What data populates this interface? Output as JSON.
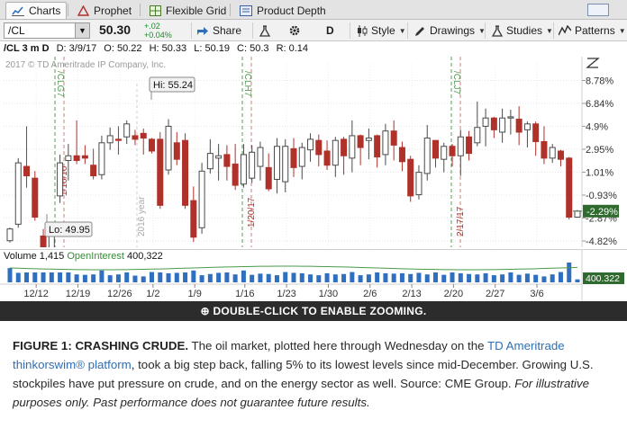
{
  "tabs": [
    {
      "label": "Charts",
      "icon": "chart-icon",
      "active": true
    },
    {
      "label": "Prophet",
      "icon": "prophet-icon",
      "active": false
    },
    {
      "label": "Flexible Grid",
      "icon": "grid-icon",
      "active": false
    },
    {
      "label": "Product Depth",
      "icon": "depth-icon",
      "active": false
    }
  ],
  "toolbar": {
    "symbol": "/CL",
    "last": "50.30",
    "change": "+.02",
    "change_pct": "+0.04%",
    "share": "Share",
    "period": "D",
    "style": "Style",
    "drawings": "Drawings",
    "studies": "Studies",
    "patterns": "Patterns"
  },
  "info": {
    "symbol": "/CL 3 m D",
    "date": "D: 3/9/17",
    "open": "O: 50.22",
    "high": "H: 50.33",
    "low": "L: 50.19",
    "close": "C: 50.3",
    "range": "R: 0.14"
  },
  "copyright": "2017 © TD Ameritrade IP Company, Inc.",
  "chart_data": {
    "type": "candlestick",
    "y_axis": {
      "unit": "percent",
      "ticks": [
        "8.78%",
        "6.84%",
        "4.9%",
        "2.95%",
        "1.01%",
        "-0.93%",
        "-2.87%",
        "-4.82%"
      ]
    },
    "x_ticks": [
      "12/12",
      "12/19",
      "12/26",
      "1/2",
      "1/9",
      "1/16",
      "1/23",
      "1/30",
      "2/6",
      "2/13",
      "2/20",
      "2/27",
      "3/6"
    ],
    "current_value_label": "-2.29%",
    "hi_label": "Hi: 55.24",
    "lo_label": "Lo: 49.95",
    "expiry_markers": [
      "/CLG7",
      "1/16/16",
      "/CLH7",
      "1/20/17",
      "/CLJ7",
      "2/17/17"
    ],
    "year_marker": "2016 year",
    "candles": [
      [
        -4.8,
        -3.8,
        -4.95,
        -3.7
      ],
      [
        -3.4,
        1.8,
        -3.7,
        2.2
      ],
      [
        1.5,
        0.7,
        -0.3,
        4.9
      ],
      [
        0.5,
        -2.8,
        -3.1,
        1.1
      ],
      [
        -4.4,
        -6.2,
        -6.7,
        -3.8
      ],
      [
        -5.5,
        -3.7,
        -5.8,
        -3.3
      ],
      [
        -1.0,
        1.8,
        -1.6,
        2.5
      ],
      [
        2.0,
        2.4,
        0.3,
        3.4
      ],
      [
        2.4,
        2.0,
        1.7,
        5.4
      ],
      [
        2.4,
        2.2,
        1.7,
        3.3
      ],
      [
        1.6,
        0.7,
        0.4,
        3.0
      ],
      [
        0.8,
        3.5,
        0.4,
        4.1
      ],
      [
        3.5,
        4.1,
        2.9,
        4.8
      ],
      [
        3.8,
        3.7,
        2.5,
        4.9
      ],
      [
        4.0,
        5.1,
        3.4,
        5.4
      ],
      [
        4.1,
        3.8,
        3.3,
        4.6
      ],
      [
        4.3,
        3.9,
        2.5,
        4.7
      ],
      [
        3.8,
        2.8,
        2.6,
        3.9
      ],
      [
        3.8,
        -1.8,
        -2.1,
        4.4
      ],
      [
        1.2,
        4.9,
        0.8,
        5.5
      ],
      [
        3.5,
        2.1,
        1.6,
        4.4
      ],
      [
        3.7,
        -1.8,
        -2.1,
        4.3
      ],
      [
        -1.4,
        -4.5,
        -4.9,
        -0.2
      ],
      [
        -3.7,
        1.1,
        -4.2,
        1.8
      ],
      [
        1.3,
        2.6,
        0.9,
        3.8
      ],
      [
        2.2,
        2.4,
        0.3,
        3.4
      ],
      [
        2.5,
        1.5,
        0.3,
        3.3
      ],
      [
        1.7,
        -0.1,
        -0.5,
        3.4
      ],
      [
        0.0,
        2.5,
        -0.3,
        3.4
      ],
      [
        0.5,
        2.7,
        0.1,
        3.3
      ],
      [
        1.5,
        3.1,
        0.3,
        3.6
      ],
      [
        1.4,
        -0.4,
        -0.6,
        2.6
      ],
      [
        0.4,
        3.2,
        -0.8,
        3.9
      ],
      [
        0.2,
        3.2,
        -0.7,
        3.8
      ],
      [
        3.0,
        1.4,
        0.6,
        3.9
      ],
      [
        1.5,
        3.1,
        0.4,
        3.5
      ],
      [
        2.9,
        3.8,
        1.9,
        4.3
      ],
      [
        3.7,
        2.5,
        1.5,
        4.2
      ],
      [
        2.8,
        1.6,
        1.2,
        3.7
      ],
      [
        1.6,
        3.7,
        0.6,
        4.0
      ],
      [
        3.8,
        2.4,
        0.8,
        4.0
      ],
      [
        2.2,
        4.1,
        1.0,
        5.4
      ],
      [
        4.1,
        3.1,
        1.6,
        4.2
      ],
      [
        3.7,
        3.9,
        2.1,
        4.7
      ],
      [
        4.1,
        2.3,
        1.4,
        4.2
      ],
      [
        2.5,
        4.5,
        1.6,
        5.1
      ],
      [
        4.5,
        3.3,
        2.0,
        5.4
      ],
      [
        3.1,
        1.9,
        1.1,
        3.6
      ],
      [
        2.1,
        -1.0,
        -1.5,
        2.4
      ],
      [
        -0.9,
        1.0,
        -1.3,
        1.6
      ],
      [
        0.9,
        3.9,
        0.3,
        5.0
      ],
      [
        3.7,
        2.2,
        1.4,
        3.7
      ],
      [
        2.1,
        3.2,
        1.0,
        3.5
      ],
      [
        3.2,
        2.4,
        1.5,
        3.4
      ],
      [
        2.4,
        4.0,
        0.7,
        4.6
      ],
      [
        4.0,
        2.6,
        2.0,
        4.5
      ],
      [
        3.5,
        4.8,
        3.2,
        7.0
      ],
      [
        4.9,
        5.6,
        3.2,
        6.4
      ],
      [
        5.6,
        4.6,
        3.9,
        5.7
      ],
      [
        4.4,
        5.6,
        3.5,
        6.4
      ],
      [
        5.6,
        5.7,
        4.2,
        6.3
      ],
      [
        5.5,
        4.4,
        3.3,
        6.6
      ],
      [
        4.6,
        5.1,
        3.1,
        5.3
      ],
      [
        5.1,
        3.6,
        2.4,
        5.3
      ],
      [
        3.6,
        2.2,
        1.7,
        4.9
      ],
      [
        2.2,
        3.1,
        1.8,
        3.4
      ],
      [
        2.8,
        2.1,
        1.5,
        2.9
      ],
      [
        2.2,
        -2.8,
        -3.0,
        2.3
      ],
      [
        -2.8,
        -2.29,
        -2.8,
        -2.2
      ]
    ],
    "volume": {
      "label": "Volume",
      "value": "1,415",
      "oi_label": "OpenInterest",
      "oi_value": "400,322",
      "axis_label": "400.322"
    }
  },
  "banner": "DOUBLE-CLICK TO ENABLE ZOOMING.",
  "caption": {
    "title": "FIGURE 1: CRASHING CRUDE.",
    "text1": " The oil market, plotted here through Wednesday on the ",
    "link": "TD Ameritrade thinkorswim® platform",
    "text2": ", took a big step back, falling 5% to its lowest levels since mid-December. Growing U.S. stockpiles have put pressure on crude, and on the energy sector as well. Source: CME Group. ",
    "disclaimer": "For illustrative purposes only. Past performance does not guarantee future results."
  },
  "colors": {
    "up": "#2f7d2f",
    "down": "#b0302a",
    "accent": "#2f6fb5"
  }
}
